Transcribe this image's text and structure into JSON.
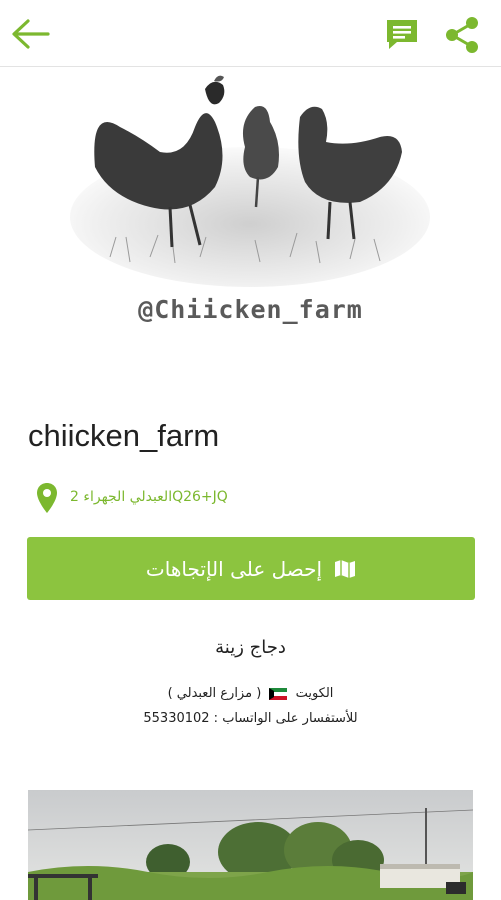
{
  "topbar": {
    "back_icon": "arrow-left-icon",
    "comment_icon": "comment-icon",
    "share_icon": "share-icon",
    "accent_color": "#7cb82f"
  },
  "hero": {
    "caption": "@Chiicken_farm",
    "image_subject": "chickens-sketch"
  },
  "place": {
    "name": "chiicken_farm",
    "location_text": "العبدلي الجهراء 2Q26+JQ",
    "location_icon": "map-pin-icon"
  },
  "directions_button": {
    "label": "إحصل على الإتجاهات",
    "icon": "map-icon",
    "color": "#8cc43f"
  },
  "description": {
    "title": "دجاج زينة",
    "line1_a": "الكويت",
    "line1_b": "( مزارع العبدلي )",
    "line2": "للأستفسار على الواتساب : 55330102"
  },
  "photo": {
    "subject": "farm-photo"
  }
}
